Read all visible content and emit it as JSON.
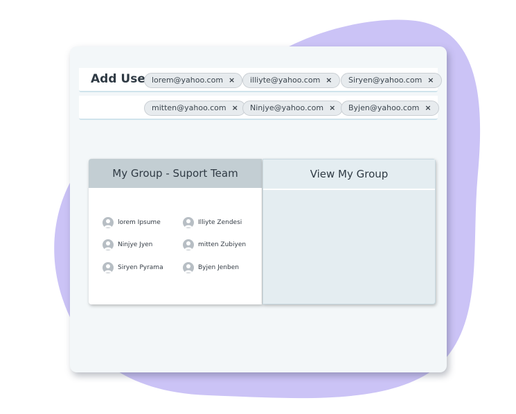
{
  "add_user": {
    "label": "Add User",
    "emails": [
      {
        "email": "lorem@yahoo.com"
      },
      {
        "email": "illiyte@yahoo.com"
      },
      {
        "email": "Siryen@yahoo.com"
      },
      {
        "email": "mitten@yahoo.com"
      },
      {
        "email": "Ninjye@yahoo.com"
      },
      {
        "email": "Byjen@yahoo.com"
      }
    ],
    "remove_glyph": "×"
  },
  "group_panel": {
    "title": "My Group - Suport Team",
    "members": [
      "lorem Ipsume",
      "Illiyte Zendesi",
      "Ninjye Jyen",
      "mitten Zubiyen",
      "Siryen Pyrama",
      "Byjen Jenben"
    ]
  },
  "view_panel": {
    "title": "View My Group"
  },
  "colors": {
    "blob": "#cbc3f6",
    "header_left": "#c3ced3",
    "panel_right": "#e4edf1",
    "avatar": "#b7bec4"
  },
  "icons": {
    "chip_remove": "close-icon",
    "member_avatar": "user-avatar-icon"
  }
}
